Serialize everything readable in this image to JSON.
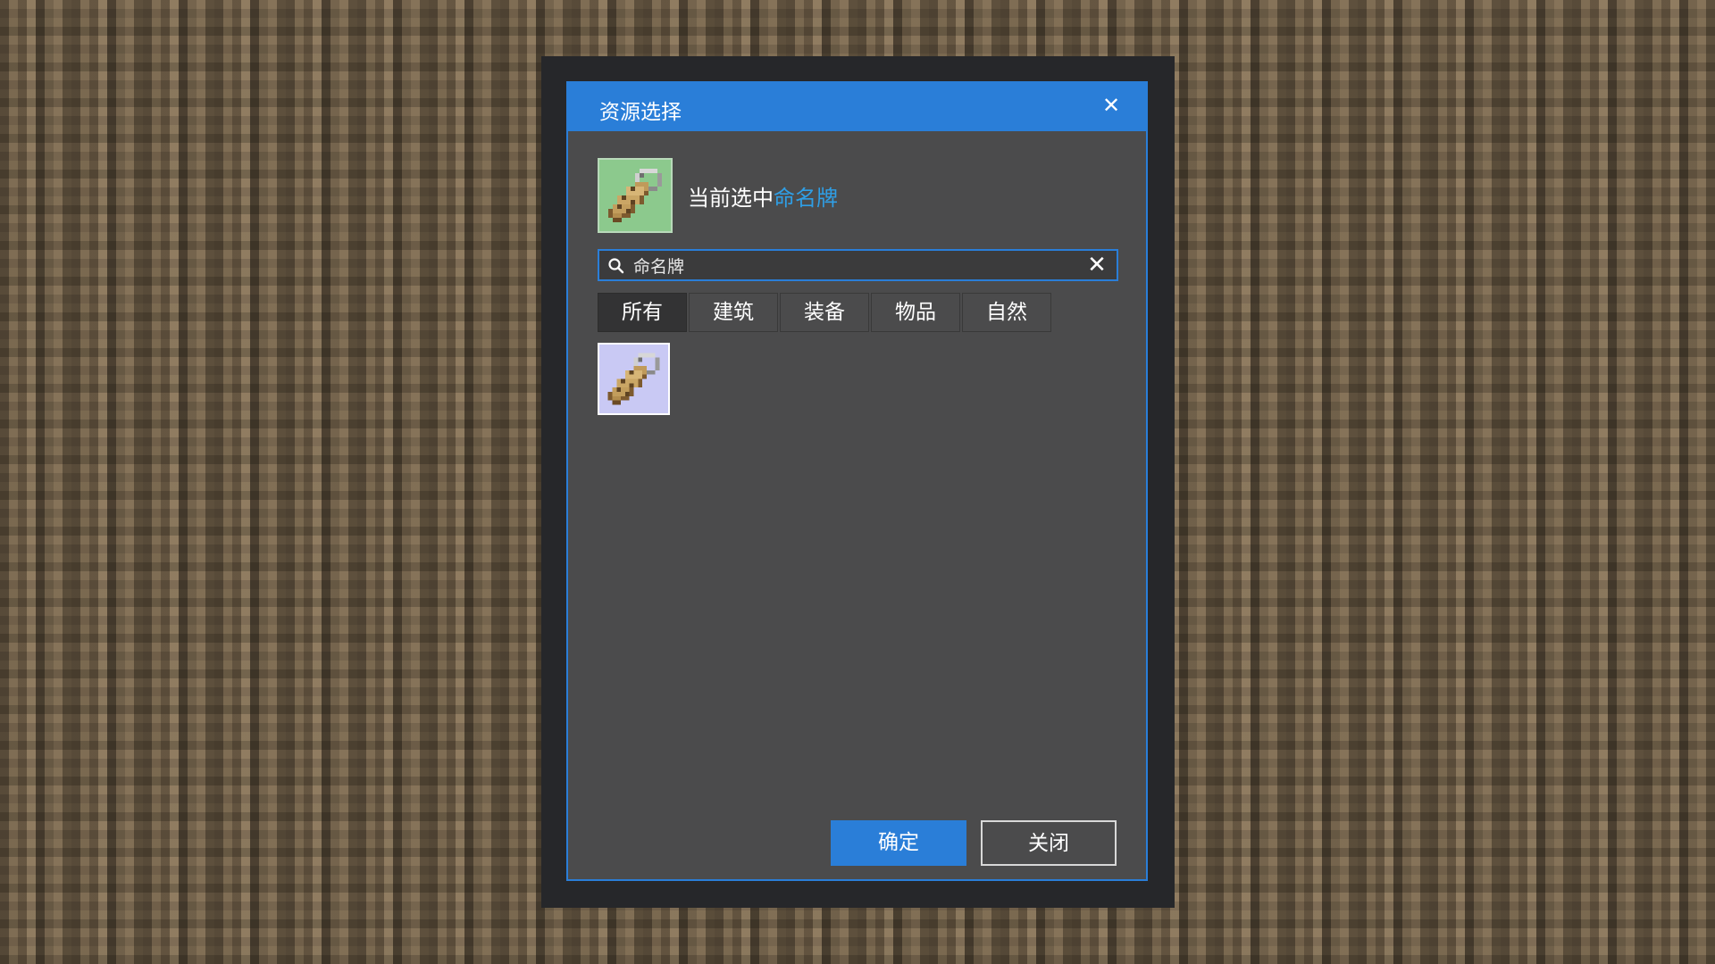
{
  "dialog": {
    "title": "资源选择",
    "close_glyph": "✕"
  },
  "selected": {
    "prefix": "当前选中",
    "name": "命名牌",
    "icon": "name-tag-icon"
  },
  "search": {
    "value": "命名牌",
    "placeholder": "",
    "clear_glyph": "✕"
  },
  "tabs": [
    {
      "label": "所有",
      "active": true
    },
    {
      "label": "建筑",
      "active": false
    },
    {
      "label": "装备",
      "active": false
    },
    {
      "label": "物品",
      "active": false
    },
    {
      "label": "自然",
      "active": false
    }
  ],
  "results": [
    {
      "icon": "name-tag-icon",
      "selected": true
    }
  ],
  "buttons": {
    "ok": "确定",
    "close": "关闭"
  },
  "colors": {
    "accent": "#2a7ed8",
    "highlight_text": "#2f9fe6",
    "panel_bg": "#4b4b4c",
    "selected_thumb_bg": "#8cc98d",
    "grid_item_bg": "#c9c9f4"
  }
}
